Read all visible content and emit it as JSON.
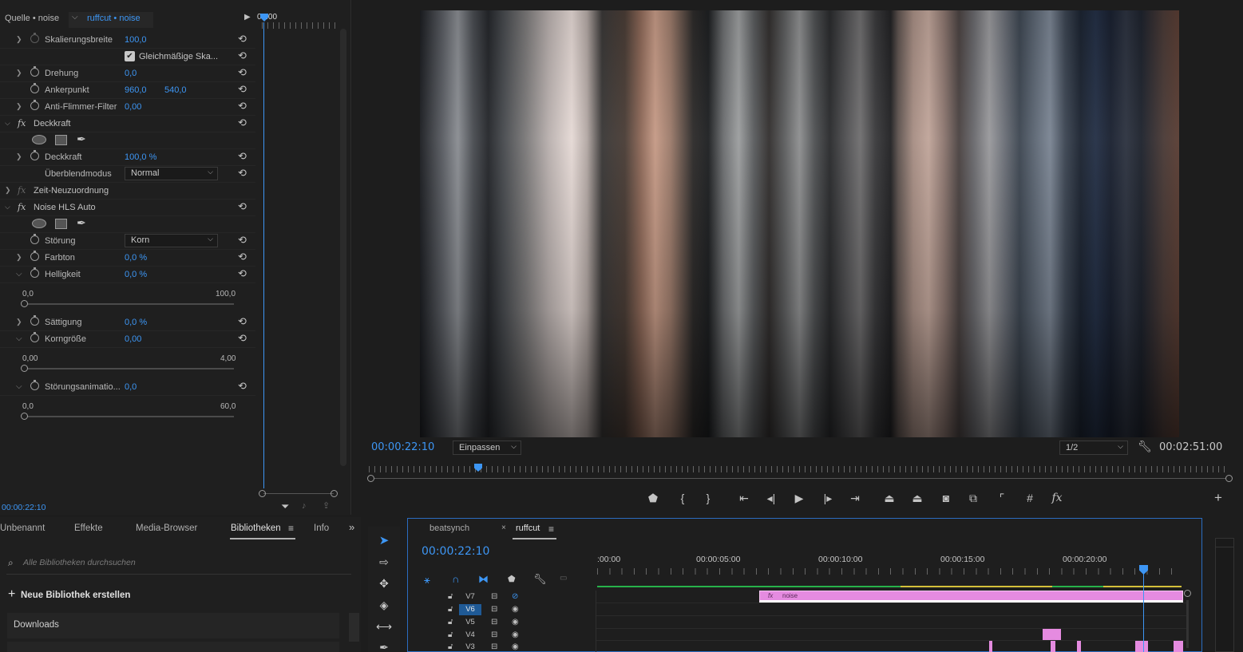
{
  "effect_controls": {
    "tabs": [
      "Quelle • noise",
      "ruffcut • noise"
    ],
    "timecode_top": "00:00",
    "rows": {
      "scale_width_label": "Skalierungsbreite",
      "scale_width_value": "100,0",
      "uniform_label": "Gleichmäßige Ska...",
      "rotation_label": "Drehung",
      "rotation_value": "0,0",
      "anchor_label": "Ankerpunkt",
      "anchor_x": "960,0",
      "anchor_y": "540,0",
      "antiflicker_label": "Anti-Flimmer-Filter",
      "antiflicker_value": "0,00",
      "opacity_section": "Deckkraft",
      "opacity_label": "Deckkraft",
      "opacity_value": "100,0 %",
      "blend_label": "Überblendmodus",
      "blend_value": "Normal",
      "time_remap_section": "Zeit-Neuzuordnung",
      "noise_section": "Noise HLS Auto",
      "noise_type_label": "Störung",
      "noise_type_value": "Korn",
      "hue_label": "Farbton",
      "hue_value": "0,0 %",
      "lightness_label": "Helligkeit",
      "lightness_value": "0,0 %",
      "lightness_min": "0,0",
      "lightness_max": "100,0",
      "saturation_label": "Sättigung",
      "saturation_value": "0,0 %",
      "grain_label": "Korngröße",
      "grain_value": "0,00",
      "grain_min": "0,00",
      "grain_max": "4,00",
      "anim_label": "Störungsanimatio...",
      "anim_value": "0,0",
      "anim_min": "0,0",
      "anim_max": "60,0"
    },
    "timecode_bottom": "00:00:22:10"
  },
  "monitor": {
    "current_timecode": "00:00:22:10",
    "zoom": "Einpassen",
    "resolution": "1/2",
    "duration": "00:02:51:00",
    "controls": [
      "marker",
      "mark-in",
      "mark-out",
      "go-to-in",
      "step-back",
      "play",
      "step-forward",
      "go-to-out",
      "lift",
      "extract",
      "export-frame",
      "comparison-view",
      "safe-margins",
      "grid",
      "fx",
      "add"
    ]
  },
  "libraries": {
    "tabs": [
      "Unbenannt",
      "Effekte",
      "Media-Browser",
      "Bibliotheken",
      "Info"
    ],
    "active_tab": "Bibliotheken",
    "search_placeholder": "Alle Bibliotheken durchsuchen",
    "new_library": "Neue Bibliothek erstellen",
    "items": [
      "Downloads"
    ]
  },
  "timeline": {
    "tabs": [
      "beatsynch",
      "ruffcut"
    ],
    "active_tab": "ruffcut",
    "timecode": "00:00:22:10",
    "ruler_labels": [
      ":00:00",
      "00:00:05:00",
      "00:00:10:00",
      "00:00:15:00",
      "00:00:20:00"
    ],
    "tracks": [
      "V7",
      "V6",
      "V5",
      "V4",
      "V3"
    ],
    "active_track": "V6",
    "clip_label": "noise",
    "colors": {
      "clip": "#e58be0",
      "accent": "#3d96f4",
      "work_area_green": "#27b24a",
      "work_area_yellow": "#d4c03a"
    }
  }
}
